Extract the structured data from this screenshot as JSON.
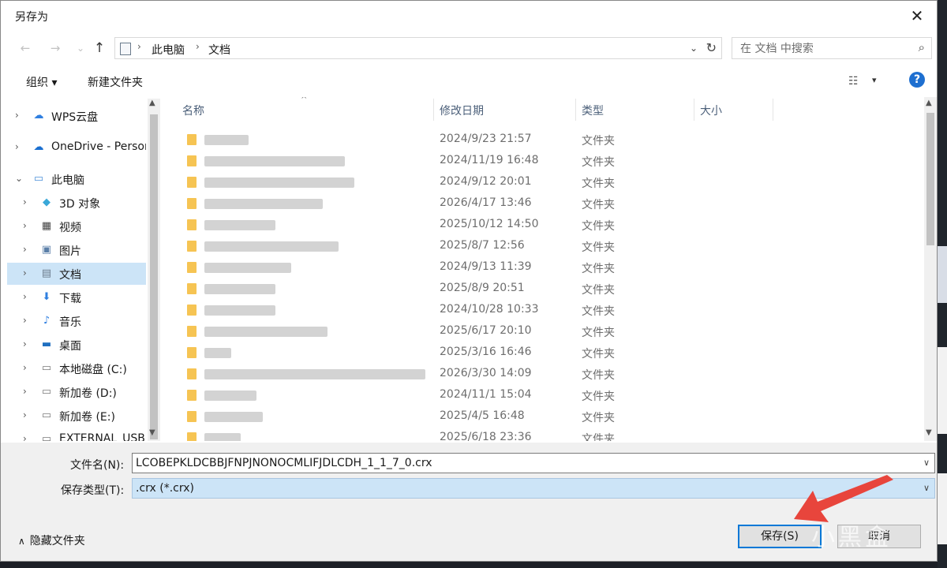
{
  "window": {
    "title": "另存为",
    "close_icon": "close-icon"
  },
  "nav": {
    "back_icon": "←",
    "forward_icon": "→",
    "recent_icon": "⌄",
    "up_icon": "↑",
    "breadcrumb": [
      "此电脑",
      "文档"
    ],
    "search_placeholder": "在 文档 中搜索"
  },
  "toolbar": {
    "organize": "组织 ▾",
    "new_folder": "新建文件夹",
    "help": "?"
  },
  "tree": {
    "items": [
      {
        "label": "WPS云盘",
        "icon": "cloud-icon",
        "color": "#2f7fe0"
      },
      {
        "label": "OneDrive - Personal",
        "icon": "cloud-icon",
        "color": "#1a6fd0"
      },
      {
        "label": "此电脑",
        "icon": "computer-icon",
        "color": "#4a90d9"
      },
      {
        "label": "3D 对象",
        "icon": "cube-icon",
        "color": "#3aa8d8"
      },
      {
        "label": "视频",
        "icon": "film-icon",
        "color": "#444444"
      },
      {
        "label": "图片",
        "icon": "picture-icon",
        "color": "#5b7fa8"
      },
      {
        "label": "文档",
        "icon": "document-icon",
        "color": "#6b7b8c"
      },
      {
        "label": "下载",
        "icon": "download-icon",
        "color": "#2f7fe0"
      },
      {
        "label": "音乐",
        "icon": "music-icon",
        "color": "#2f7fe0"
      },
      {
        "label": "桌面",
        "icon": "desktop-icon",
        "color": "#1f6fc0"
      },
      {
        "label": "本地磁盘 (C:)",
        "icon": "drive-icon",
        "color": "#7a7a7a"
      },
      {
        "label": "新加卷 (D:)",
        "icon": "drive-icon",
        "color": "#7a7a7a"
      },
      {
        "label": "新加卷 (E:)",
        "icon": "drive-icon",
        "color": "#7a7a7a"
      },
      {
        "label": "EXTERNAL_USB",
        "icon": "drive-icon",
        "color": "#7a7a7a"
      }
    ]
  },
  "columns": {
    "name": "名称",
    "modified": "修改日期",
    "type": "类型",
    "size": "大小"
  },
  "files": [
    {
      "date": "2024/9/23 21:57",
      "type": "文件夹"
    },
    {
      "date": "2024/11/19 16:48",
      "type": "文件夹"
    },
    {
      "date": "2024/9/12 20:01",
      "type": "文件夹"
    },
    {
      "date": "2026/4/17 13:46",
      "type": "文件夹"
    },
    {
      "date": "2025/10/12 14:50",
      "type": "文件夹"
    },
    {
      "date": "2025/8/7 12:56",
      "type": "文件夹"
    },
    {
      "date": "2024/9/13 11:39",
      "type": "文件夹"
    },
    {
      "date": "2025/8/9 20:51",
      "type": "文件夹"
    },
    {
      "date": "2024/10/28 10:33",
      "type": "文件夹"
    },
    {
      "date": "2025/6/17 20:10",
      "type": "文件夹"
    },
    {
      "date": "2025/3/16 16:46",
      "type": "文件夹"
    },
    {
      "date": "2026/3/30 14:09",
      "type": "文件夹"
    },
    {
      "date": "2024/11/1 15:04",
      "type": "文件夹"
    },
    {
      "date": "2025/4/5 16:48",
      "type": "文件夹"
    },
    {
      "date": "2025/6/18 23:36",
      "type": "文件夹"
    }
  ],
  "form": {
    "filename_label": "文件名(N):",
    "filename_value": "LCOBEPKLDCBBJFNPJNONOCMLIFJDLCDH_1_1_7_0.crx",
    "filetype_label": "保存类型(T):",
    "filetype_value": ".crx (*.crx)"
  },
  "footer": {
    "hide_folders": "隐藏文件夹",
    "save": "保存(S)",
    "cancel": "取消"
  },
  "watermark": "小黑盒",
  "colors": {
    "accent": "#0078d7",
    "selection": "#cce4f7",
    "folder": "#f6c453",
    "annotation_arrow": "#e8453c"
  }
}
